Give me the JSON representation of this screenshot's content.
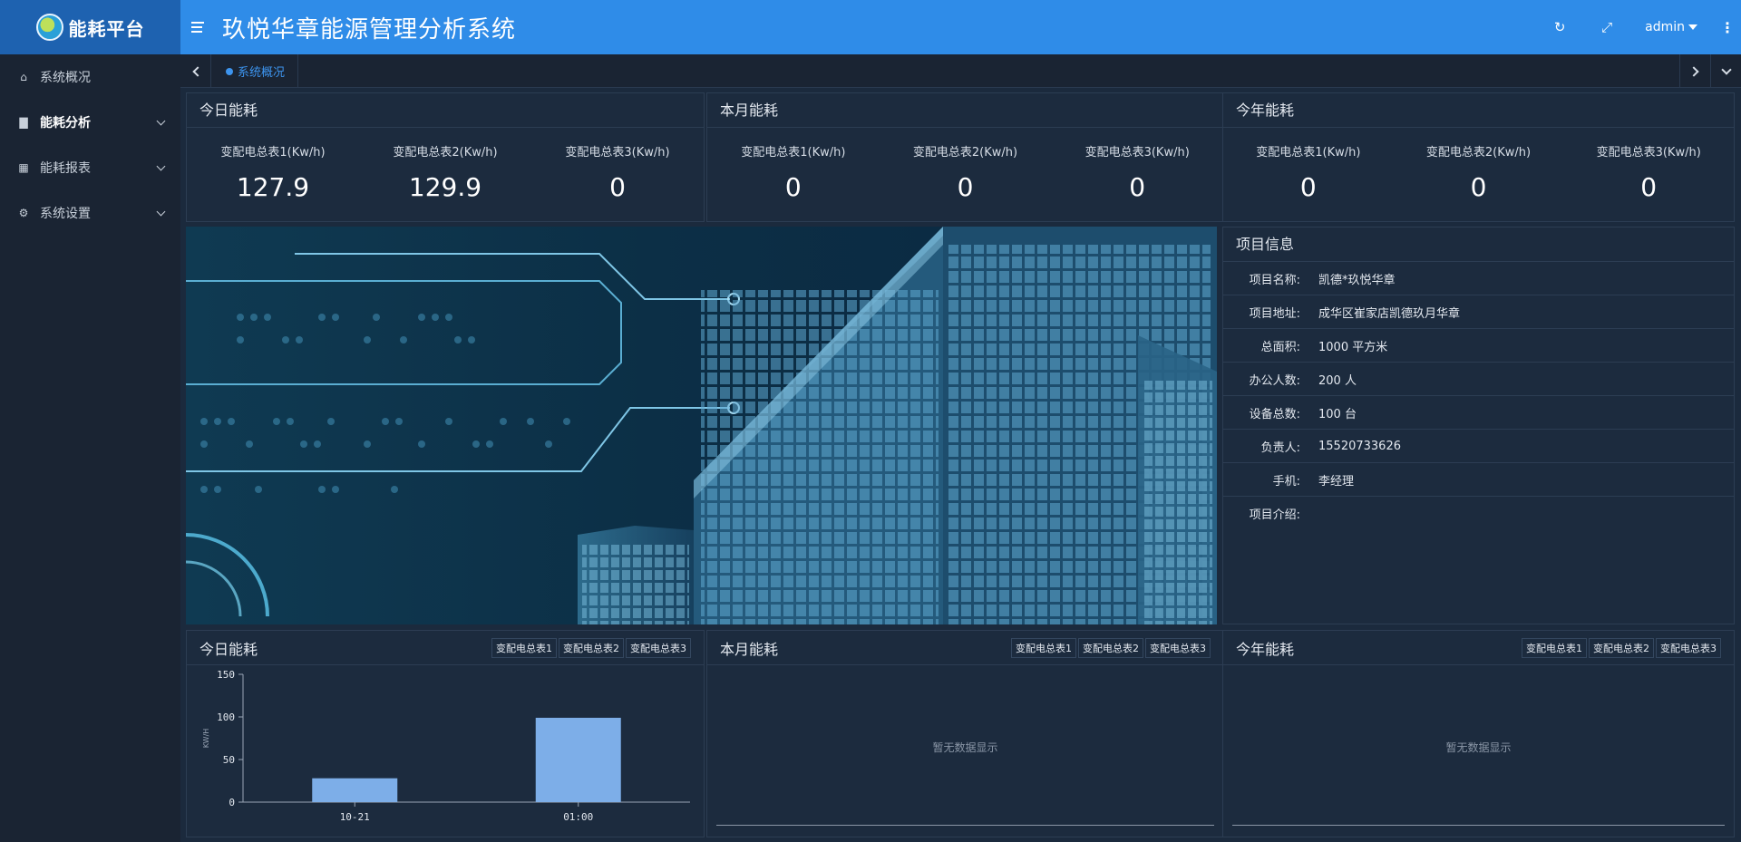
{
  "header": {
    "logo_text": "能耗平台",
    "title": "玖悦华章能源管理分析系统",
    "user": "admin",
    "icons": [
      "menu-icon",
      "refresh-icon",
      "fullscreen-icon",
      "more-vertical-icon"
    ]
  },
  "sidebar": {
    "items": [
      {
        "label": "系统概况",
        "icon": "home-icon"
      },
      {
        "label": "能耗分析",
        "icon": "bar-chart-icon"
      },
      {
        "label": "能耗报表",
        "icon": "table-icon"
      },
      {
        "label": "系统设置",
        "icon": "gear-icon"
      }
    ]
  },
  "tabs": {
    "active": "系统概况"
  },
  "stats_today": {
    "title": "今日能耗",
    "items": [
      {
        "label": "变配电总表1(Kw/h)",
        "value": "127.9"
      },
      {
        "label": "变配电总表2(Kw/h)",
        "value": "129.9"
      },
      {
        "label": "变配电总表3(Kw/h)",
        "value": "0"
      }
    ]
  },
  "stats_month": {
    "title": "本月能耗",
    "items": [
      {
        "label": "变配电总表1(Kw/h)",
        "value": "0"
      },
      {
        "label": "变配电总表2(Kw/h)",
        "value": "0"
      },
      {
        "label": "变配电总表3(Kw/h)",
        "value": "0"
      }
    ]
  },
  "stats_year": {
    "title": "今年能耗",
    "items": [
      {
        "label": "变配电总表1(Kw/h)",
        "value": "0"
      },
      {
        "label": "变配电总表2(Kw/h)",
        "value": "0"
      },
      {
        "label": "变配电总表3(Kw/h)",
        "value": "0"
      }
    ]
  },
  "project": {
    "title": "项目信息",
    "rows": [
      {
        "k": "项目名称:",
        "v": "凯德*玖悦华章"
      },
      {
        "k": "项目地址:",
        "v": "成华区崔家店凯德玖月华章"
      },
      {
        "k": "总面积:",
        "v": "1000 平方米"
      },
      {
        "k": "办公人数:",
        "v": "200 人"
      },
      {
        "k": "设备总数:",
        "v": "100 台"
      },
      {
        "k": "负责人:",
        "v": "15520733626"
      },
      {
        "k": "手机:",
        "v": "李经理"
      },
      {
        "k": "项目介绍:",
        "v": ""
      }
    ]
  },
  "meter_buttons": [
    "变配电总表1",
    "变配电总表2",
    "变配电总表3"
  ],
  "chart_today_title": "今日能耗",
  "chart_month_title": "本月能耗",
  "chart_year_title": "今年能耗",
  "empty_text": "暂无数据显示",
  "colors": {
    "accent": "#2f8ce8",
    "bar": "#7daee8",
    "panel": "#1c2b3e"
  },
  "chart_data": {
    "type": "bar",
    "categories": [
      "10-21",
      "01:00"
    ],
    "values": [
      28,
      99
    ],
    "ylabel": "KW/H",
    "ylim": [
      0,
      150
    ],
    "yticks": [
      0,
      50,
      100,
      150
    ]
  }
}
